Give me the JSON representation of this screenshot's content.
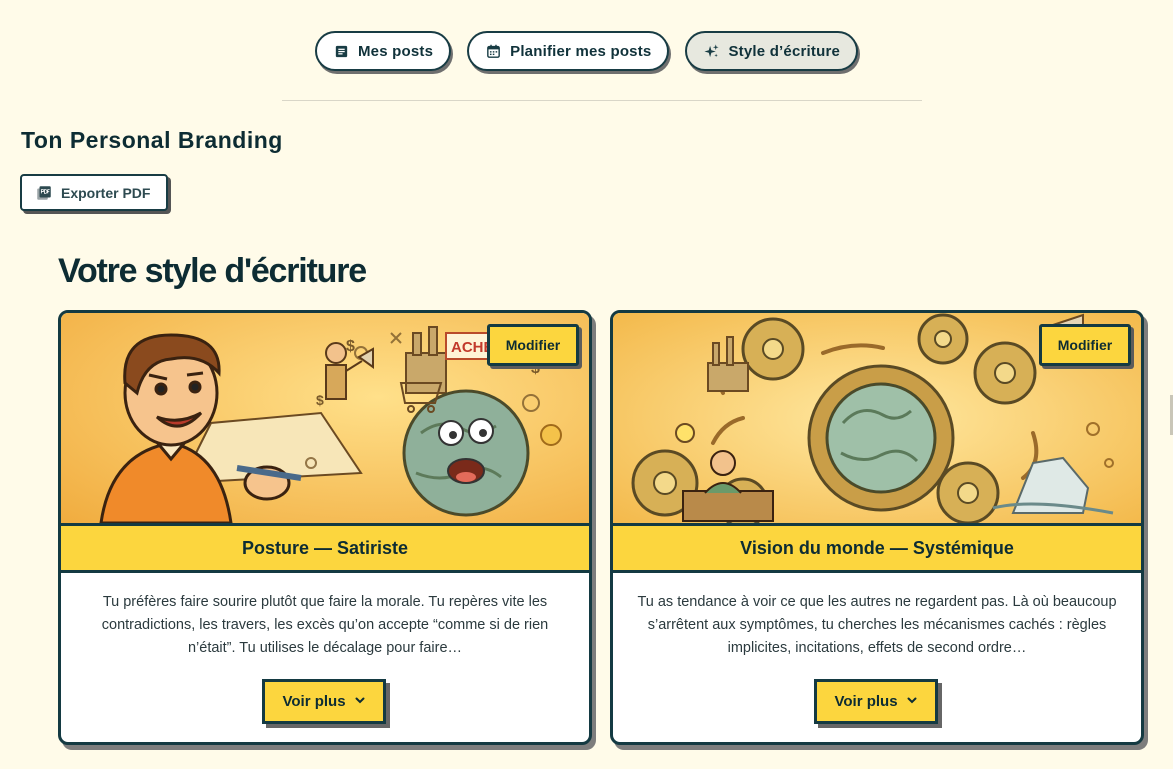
{
  "nav": {
    "items": [
      {
        "label": "Mes posts",
        "icon": "article-icon",
        "active": false
      },
      {
        "label": "Planifier mes posts",
        "icon": "calendar-icon",
        "active": false
      },
      {
        "label": "Style d’écriture",
        "icon": "sparkles-icon",
        "active": true
      }
    ]
  },
  "brand": {
    "title": "Ton Personal Branding"
  },
  "export": {
    "label": "Exporter PDF",
    "icon": "pdf-icon"
  },
  "section": {
    "title": "Votre style d'écriture"
  },
  "cards": [
    {
      "edit_label": "Modifier",
      "title": "Posture — Satiriste",
      "text": "Tu préfères faire sourire plutôt que faire la morale. Tu repères vite les contradictions, les travers, les excès qu’on accepte “comme si de rien n’était”. Tu utilises le décalage pour faire…",
      "more_label": "Voir plus",
      "image_icon": "satirist-illustration",
      "image_sign": "ACHE"
    },
    {
      "edit_label": "Modifier",
      "title": "Vision du monde — Systémique",
      "text": "Tu as tendance à voir ce que les autres ne regardent pas. Là où beaucoup s’arrêtent aux symptômes, tu cherches les mécanismes cachés : règles implicites, incitations, effets de second ordre…",
      "more_label": "Voir plus",
      "image_icon": "systemic-gears-illustration"
    }
  ],
  "colors": {
    "background": "#fffbe9",
    "accent_yellow": "#fcd63e",
    "border_dark": "#143a42",
    "text_dark": "#0d2c33"
  }
}
